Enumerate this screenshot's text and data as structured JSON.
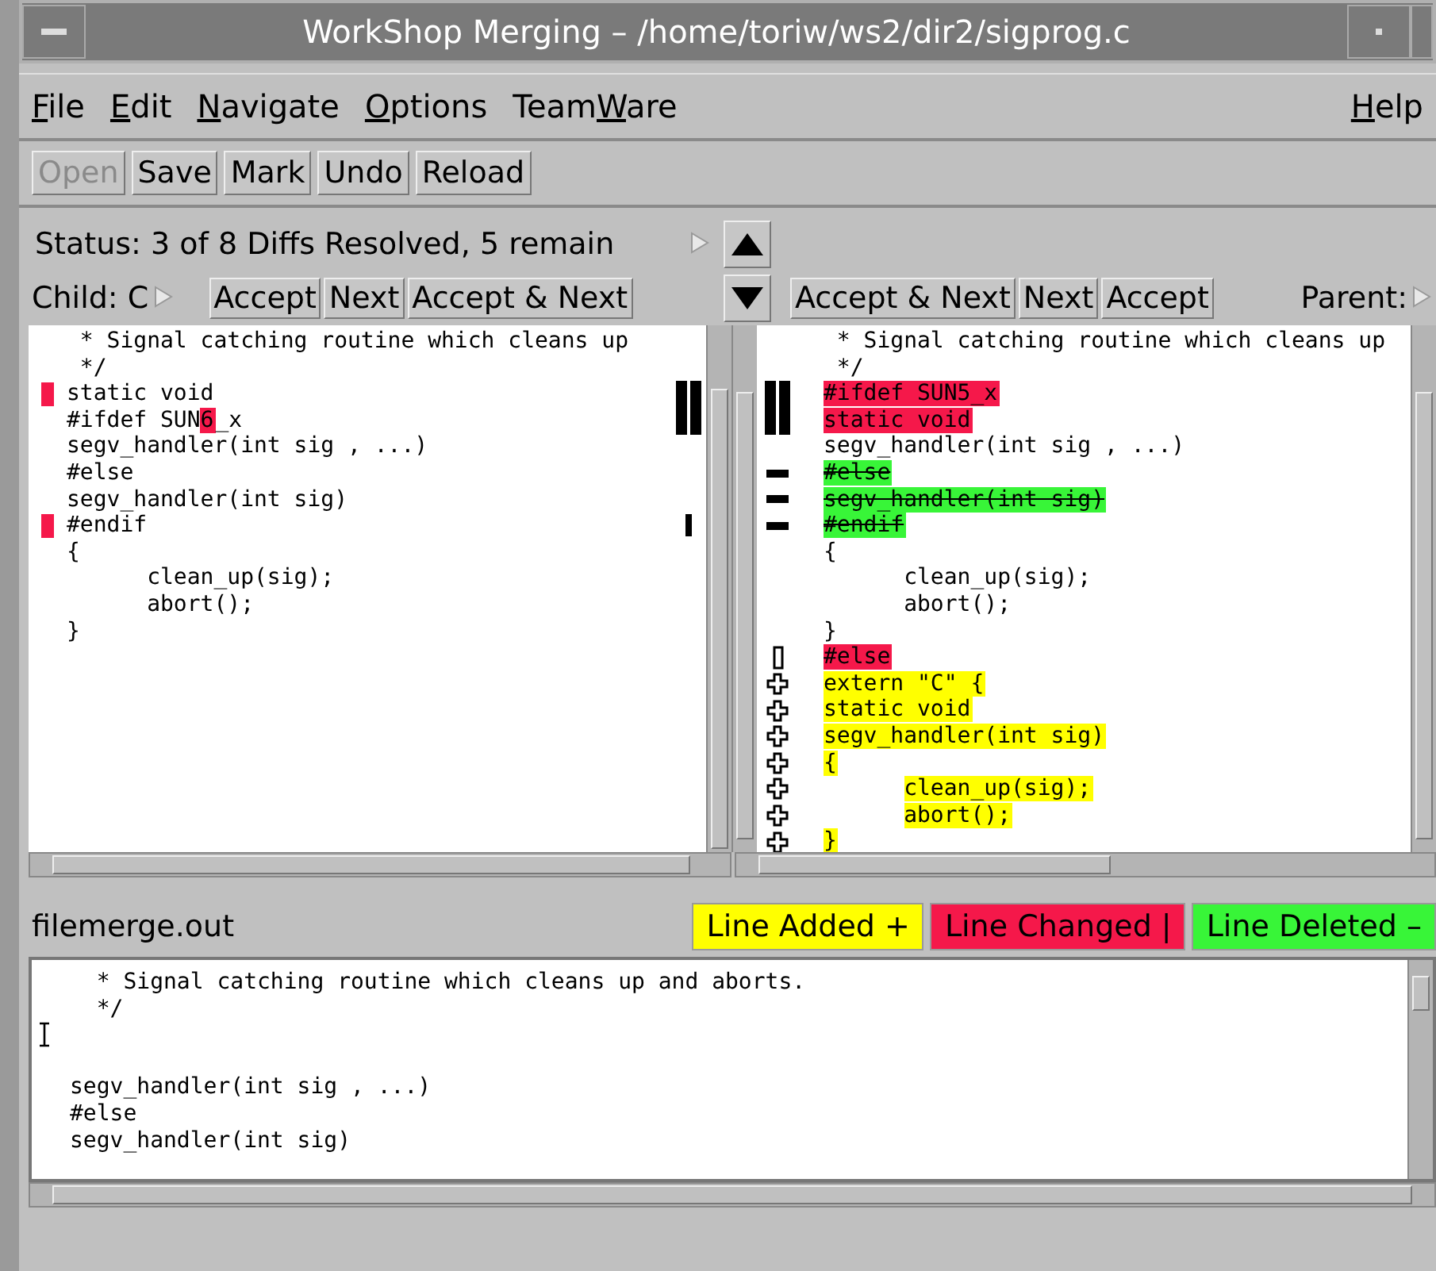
{
  "window": {
    "title": "WorkShop Merging – /home/toriw/ws2/dir2/sigprog.c"
  },
  "menu": [
    {
      "key": "F",
      "post": "ile"
    },
    {
      "key": "E",
      "post": "dit"
    },
    {
      "key": "N",
      "post": "avigate"
    },
    {
      "key": "O",
      "post": "ptions"
    },
    {
      "pre": "Team",
      "key": "W",
      "post": "are"
    }
  ],
  "help_menu": {
    "key": "H",
    "post": "elp"
  },
  "toolbar": [
    {
      "label": "Open",
      "disabled": true
    },
    {
      "label": "Save",
      "disabled": false
    },
    {
      "label": "Mark",
      "disabled": false
    },
    {
      "label": "Undo",
      "disabled": false
    },
    {
      "label": "Reload",
      "disabled": false
    }
  ],
  "status": {
    "text": "Status: 3 of 8 Diffs Resolved, 5 remain"
  },
  "child": {
    "label": "Child: C",
    "buttons": [
      "Accept",
      "Next",
      "Accept & Next"
    ]
  },
  "parent": {
    "label": "Parent:",
    "buttons": [
      "Accept & Next",
      "Next",
      "Accept"
    ]
  },
  "child_pane": {
    "lines": [
      {
        "text": " * Signal catching routine which cleans up",
        "kind": "plain"
      },
      {
        "text": " */",
        "kind": "plain"
      },
      {
        "text": "static void",
        "kind": "changed",
        "marker": {
          "kind": "block"
        }
      },
      {
        "segments": [
          {
            "text": "#ifdef SUN",
            "changed": false
          },
          {
            "text": "6",
            "changed": true
          },
          {
            "text": "_x",
            "changed": false
          }
        ],
        "kind": "plain",
        "marker": {
          "kind": "block"
        }
      },
      {
        "text": "segv_handler(int sig , ...)",
        "kind": "plain"
      },
      {
        "text": "#else",
        "kind": "plain"
      },
      {
        "text": "segv_handler(int sig)",
        "kind": "plain"
      },
      {
        "text": "#endif",
        "kind": "changed",
        "marker": {
          "kind": "bar"
        }
      },
      {
        "text": "{",
        "kind": "plain"
      },
      {
        "text": "      clean_up(sig);",
        "kind": "plain"
      },
      {
        "text": "      abort();",
        "kind": "plain"
      },
      {
        "text": "}",
        "kind": "plain"
      }
    ]
  },
  "parent_pane": {
    "lines": [
      {
        "text": " * Signal catching routine which cleans up",
        "kind": "plain"
      },
      {
        "text": " */",
        "kind": "plain"
      },
      {
        "text": "#ifdef SUN5_x",
        "kind": "changed",
        "marker": {
          "kind": "block"
        }
      },
      {
        "text": "static void",
        "kind": "changed",
        "marker": {
          "kind": "block"
        }
      },
      {
        "text": "segv_handler(int sig , ...)",
        "kind": "plain"
      },
      {
        "text": "#else",
        "kind": "deleted",
        "marker": {
          "kind": "minus"
        }
      },
      {
        "text": "segv_handler(int sig)",
        "kind": "deleted",
        "marker": {
          "kind": "minus"
        }
      },
      {
        "text": "#endif",
        "kind": "deleted",
        "marker": {
          "kind": "minus"
        }
      },
      {
        "text": "{",
        "kind": "plain"
      },
      {
        "text": "      clean_up(sig);",
        "kind": "plain"
      },
      {
        "text": "      abort();",
        "kind": "plain"
      },
      {
        "text": "}",
        "kind": "plain"
      },
      {
        "text": "#else",
        "kind": "changed",
        "marker": {
          "kind": "hollow"
        }
      },
      {
        "text": "extern \"C\" {",
        "kind": "added",
        "marker": {
          "kind": "plus"
        }
      },
      {
        "text": "static void",
        "kind": "added",
        "marker": {
          "kind": "plus"
        }
      },
      {
        "text": "segv_handler(int sig)",
        "kind": "added",
        "marker": {
          "kind": "plus"
        }
      },
      {
        "text": "{",
        "kind": "added",
        "marker": {
          "kind": "plus"
        }
      },
      {
        "text": "      clean_up(sig);",
        "kind": "added",
        "marker": {
          "kind": "plus"
        }
      },
      {
        "text": "      abort();",
        "kind": "added",
        "marker": {
          "kind": "plus"
        }
      },
      {
        "text": "}",
        "kind": "added",
        "marker": {
          "kind": "plus"
        }
      }
    ]
  },
  "output": {
    "title": "filemerge.out",
    "lines": [
      {
        "kind": "text",
        "text": "  * Signal catching routine which cleans up and aborts."
      },
      {
        "kind": "text",
        "text": "  */"
      },
      {
        "kind": "cursor"
      },
      {
        "kind": "blank"
      },
      {
        "kind": "text",
        "text": "segv_handler(int sig , ...)"
      },
      {
        "kind": "text",
        "text": "#else"
      },
      {
        "kind": "text",
        "text": "segv_handler(int sig)"
      }
    ]
  },
  "legend": [
    {
      "label": "Line Added +",
      "color": "#ffff00"
    },
    {
      "label": "Line Changed |",
      "color": "#f5184a"
    },
    {
      "label": "Line Deleted –",
      "color": "#38f538"
    }
  ]
}
